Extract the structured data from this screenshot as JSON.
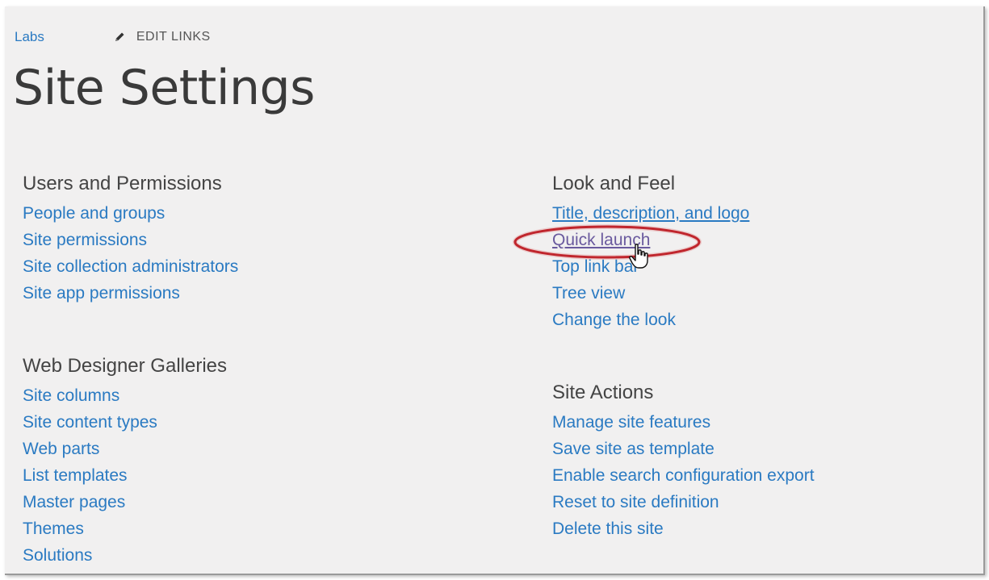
{
  "breadcrumb": {
    "site": "Labs",
    "edit_links": "EDIT LINKS"
  },
  "page_title": "Site Settings",
  "sections": {
    "users_permissions": {
      "heading": "Users and Permissions",
      "links": [
        "People and groups",
        "Site permissions",
        "Site collection administrators",
        "Site app permissions"
      ]
    },
    "web_designer": {
      "heading": "Web Designer Galleries",
      "links": [
        "Site columns",
        "Site content types",
        "Web parts",
        "List templates",
        "Master pages",
        "Themes",
        "Solutions"
      ]
    },
    "look_feel": {
      "heading": "Look and Feel",
      "links": [
        "Title, description, and logo",
        "Quick launch",
        "Top link bar",
        "Tree view",
        "Change the look"
      ]
    },
    "site_actions": {
      "heading": "Site Actions",
      "links": [
        "Manage site features",
        "Save site as template",
        "Enable search configuration export",
        "Reset to site definition",
        "Delete this site"
      ]
    }
  },
  "colors": {
    "link": "#2a7ac2",
    "visited": "#6a5a9e",
    "highlight": "#c0262d",
    "background": "#f1f0f0"
  },
  "icons": {
    "edit": "pencil-icon",
    "cursor": "hand-pointer-icon"
  }
}
